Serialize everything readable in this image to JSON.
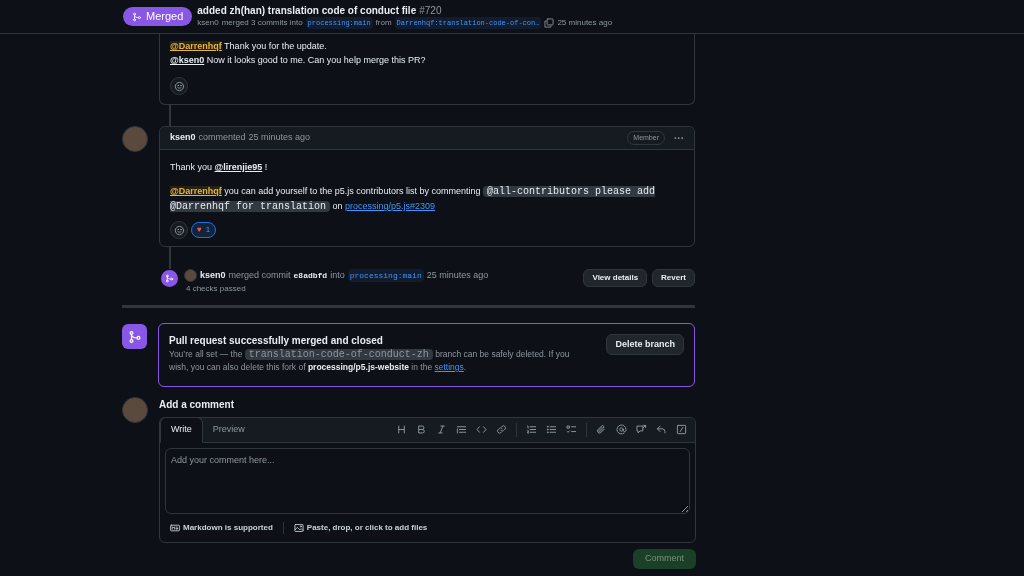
{
  "header": {
    "status": "Merged",
    "title": "added zh(han) translation code of conduct file",
    "number": "#720",
    "author": "ksen0",
    "merge_text": "merged 3 commits into",
    "base_branch": "processing:main",
    "from_text": "from",
    "head_branch": "Darrenhqf:translation-code-of-con…",
    "time": "25 minutes ago"
  },
  "previous_comment": {
    "paragraphs": [
      [
        {
          "kind": "mention-self",
          "text": "@Darrenhqf"
        },
        {
          "kind": "text",
          "text": " Thank you for the update."
        }
      ],
      [
        {
          "kind": "mention",
          "text": "@ksen0"
        },
        {
          "kind": "text",
          "text": " Now it looks good to me. Can you help merge this PR?"
        }
      ]
    ]
  },
  "comment": {
    "author": "ksen0",
    "action": "commented",
    "time": "25 minutes ago",
    "badge": "Member",
    "menu": "···",
    "paragraphs": [
      [
        {
          "kind": "text",
          "text": "Thank you "
        },
        {
          "kind": "mention",
          "text": "@lirenjie95"
        },
        {
          "kind": "text",
          "text": " !"
        }
      ],
      [
        {
          "kind": "mention-self",
          "text": "@Darrenhqf"
        },
        {
          "kind": "text",
          "text": " you can add yourself to the p5.js contributors list by commenting "
        },
        {
          "kind": "code",
          "text": "@all-contributors please add @Darrenhqf for translation"
        },
        {
          "kind": "text",
          "text": " on "
        },
        {
          "kind": "link",
          "text": "processing/p5.js#2309"
        }
      ]
    ],
    "reactions": [
      {
        "emoji": "♥",
        "count": "1",
        "selected": true
      }
    ]
  },
  "merge_event": {
    "author": "ksen0",
    "action": "merged commit",
    "commit": "e8adbfd",
    "into": "into",
    "branch": "processing:main",
    "time": "25 minutes ago",
    "checks": "4 checks passed",
    "buttons": [
      "View details",
      "Revert"
    ]
  },
  "merged_box": {
    "title": "Pull request successfully merged and closed",
    "text": [
      {
        "kind": "text",
        "text": "You’re all set — the "
      },
      {
        "kind": "code",
        "text": "translation-code-of-conduct-zh"
      },
      {
        "kind": "text",
        "text": " branch can be safely deleted. If you wish, you can also delete this fork of "
      },
      {
        "kind": "bold",
        "text": "processing/p5.js-website"
      },
      {
        "kind": "text",
        "text": " in the "
      },
      {
        "kind": "link",
        "text": "settings"
      },
      {
        "kind": "text",
        "text": "."
      }
    ],
    "button": "Delete branch"
  },
  "add_comment": {
    "title": "Add a comment",
    "tabs": [
      {
        "label": "Write",
        "selected": true
      },
      {
        "label": "Preview",
        "selected": false
      }
    ],
    "placeholder": "Add your comment here...",
    "markdown_note": "Markdown is supported",
    "files_note": "Paste, drop, or click to add files",
    "submit": {
      "label": "Comment",
      "disabled": true
    }
  }
}
